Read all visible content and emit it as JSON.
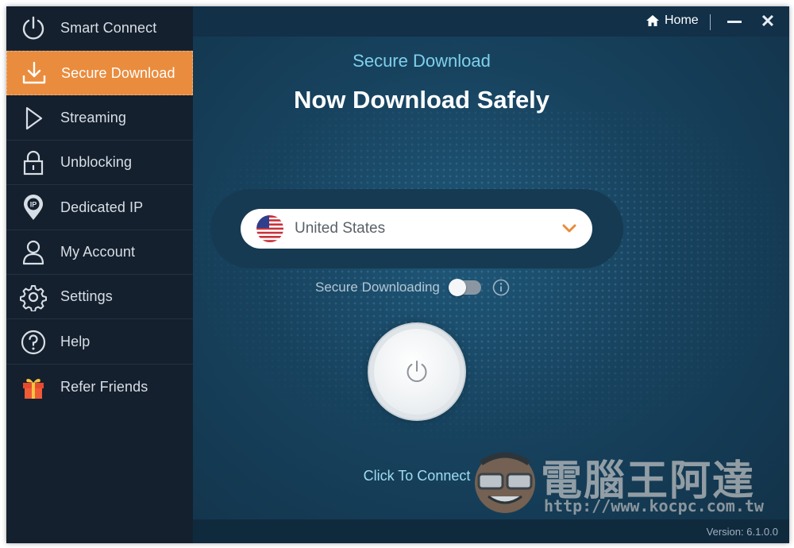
{
  "sidebar": {
    "items": [
      {
        "label": "Smart Connect",
        "icon": "power-icon",
        "active": false
      },
      {
        "label": "Secure Download",
        "icon": "download-icon",
        "active": true
      },
      {
        "label": "Streaming",
        "icon": "play-icon",
        "active": false
      },
      {
        "label": "Unblocking",
        "icon": "lock-icon",
        "active": false
      },
      {
        "label": "Dedicated IP",
        "icon": "ip-pin-icon",
        "active": false
      },
      {
        "label": "My Account",
        "icon": "user-icon",
        "active": false
      },
      {
        "label": "Settings",
        "icon": "gear-icon",
        "active": false
      },
      {
        "label": "Help",
        "icon": "help-icon",
        "active": false
      },
      {
        "label": "Refer Friends",
        "icon": "gift-icon",
        "active": false
      }
    ]
  },
  "topbar": {
    "home_label": "Home"
  },
  "main": {
    "subtitle": "Secure Download",
    "headline": "Now Download Safely",
    "country": "United States",
    "secure_label": "Secure Downloading",
    "secure_enabled": false,
    "connect_label": "Click To Connect"
  },
  "watermark": {
    "chinese": "電腦王阿達",
    "url": "http://www.kocpc.com.tw"
  },
  "footer": {
    "version": "Version:  6.1.0.0"
  },
  "colors": {
    "accent": "#ea8c3d",
    "sidebar_bg": "#14202e",
    "main_bg": "#17425e",
    "subtitle": "#7fd0ec"
  }
}
